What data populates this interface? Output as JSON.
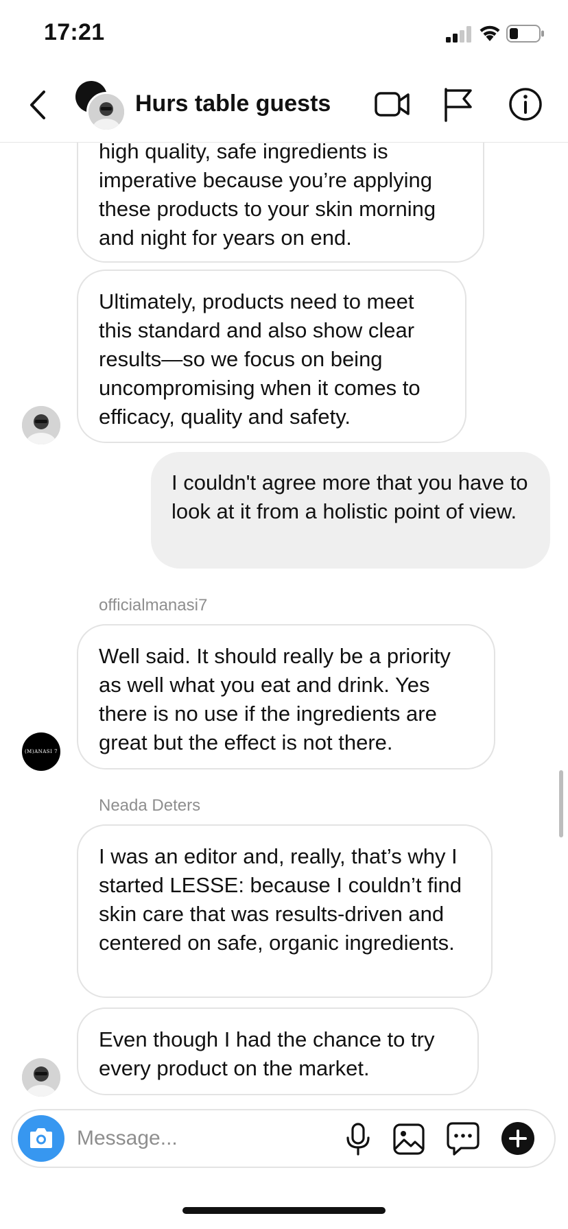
{
  "status_bar": {
    "time": "17:21",
    "icons": [
      "signal-icon",
      "wifi-icon",
      "battery-icon"
    ]
  },
  "header": {
    "title": "Hurs table guests",
    "icons": [
      "back-arrow-icon",
      "group-avatar",
      "video-camera-icon",
      "flag-icon",
      "info-icon"
    ]
  },
  "messages": [
    {
      "direction": "incoming",
      "text": "high quality, safe ingredients is imperative because you’re applying these products to your skin morning and night for years on end."
    },
    {
      "direction": "incoming",
      "text": "Ultimately, products need to meet this standard and also show clear results—so we focus on being uncompromising when it comes to efficacy, quality and safety."
    },
    {
      "direction": "outgoing",
      "text": "I couldn't agree more that you have to look at it from a holistic point of view."
    },
    {
      "direction": "incoming",
      "sender": "officialmanasi7",
      "avatar_text": "(M)ANASI 7",
      "text": "Well said. It should really be a priority as well what you eat and drink. Yes there is no use if the ingredients are great but the effect is not there."
    },
    {
      "direction": "incoming",
      "sender": "Neada Deters",
      "text": "I was an editor and, really, that’s why I started LESSE: because I couldn’t find skin care that was results-driven and centered on safe, organic ingredients."
    },
    {
      "direction": "incoming",
      "text": "Even though I had the chance to try every product on the market."
    }
  ],
  "composer": {
    "placeholder": "Message...",
    "value": "",
    "icons": [
      "camera-icon",
      "microphone-icon",
      "gallery-icon",
      "sticker-chat-icon",
      "plus-icon"
    ]
  },
  "colors": {
    "accent": "#3797f0",
    "incoming_border": "#e3e3e3",
    "outgoing_bg": "#efefef",
    "sender_gray": "#8e8e8e"
  }
}
